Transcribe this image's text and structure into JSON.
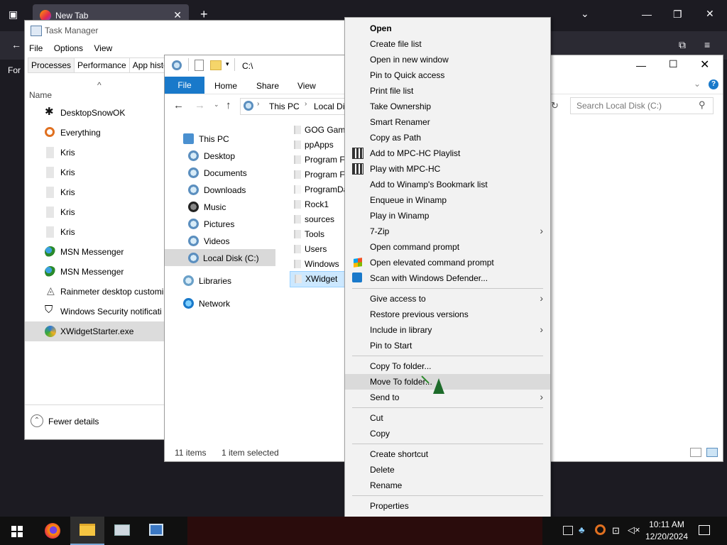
{
  "browser": {
    "tab_title": "New Tab",
    "partial_text": "For"
  },
  "taskmgr": {
    "title": "Task Manager",
    "menu": [
      "File",
      "Options",
      "View"
    ],
    "tabs": [
      "Processes",
      "Performance",
      "App histo"
    ],
    "column_name": "Name",
    "processes": [
      {
        "name": "DesktopSnowOK",
        "icon": "snowflake-icon"
      },
      {
        "name": "Everything",
        "icon": "magnifier-icon"
      },
      {
        "name": "Kris",
        "icon": "generic-app-icon"
      },
      {
        "name": "Kris",
        "icon": "generic-app-icon"
      },
      {
        "name": "Kris",
        "icon": "generic-app-icon"
      },
      {
        "name": "Kris",
        "icon": "generic-app-icon"
      },
      {
        "name": "Kris",
        "icon": "generic-app-icon"
      },
      {
        "name": "MSN Messenger",
        "icon": "msn-icon"
      },
      {
        "name": "MSN Messenger",
        "icon": "msn-icon"
      },
      {
        "name": "Rainmeter desktop customi",
        "icon": "rainmeter-icon"
      },
      {
        "name": "Windows Security notificati",
        "icon": "shield-icon"
      },
      {
        "name": "XWidgetStarter.exe",
        "icon": "xwidget-icon"
      }
    ],
    "fewer_details": "Fewer details"
  },
  "explorer": {
    "path_short": "C:\\",
    "ribbon_tabs": [
      "File",
      "Home",
      "Share",
      "View"
    ],
    "breadcrumb": [
      "This PC",
      "Local Disk"
    ],
    "search_placeholder": "Search Local Disk (C:)",
    "nav": {
      "this_pc": "This PC",
      "items": [
        "Desktop",
        "Documents",
        "Downloads",
        "Music",
        "Pictures",
        "Videos",
        "Local Disk (C:)"
      ],
      "libraries": "Libraries",
      "network": "Network"
    },
    "files": [
      "GOG Games",
      "ppApps",
      "Program Files",
      "Program Files",
      "ProgramData",
      "Rock1",
      "sources",
      "Tools",
      "Users",
      "Windows",
      "XWidget"
    ],
    "status_items": "11 items",
    "status_selected": "1 item selected"
  },
  "context_menu": {
    "items": [
      {
        "label": "Open",
        "bold": true
      },
      {
        "label": "Create file list"
      },
      {
        "label": "Open in new window"
      },
      {
        "label": "Pin to Quick access"
      },
      {
        "label": "Print file list"
      },
      {
        "label": "Take Ownership"
      },
      {
        "label": "Smart Renamer"
      },
      {
        "label": "Copy as Path"
      },
      {
        "label": "Add to MPC-HC Playlist",
        "icon": "mpc-hc-icon"
      },
      {
        "label": "Play with MPC-HC",
        "icon": "mpc-hc-icon"
      },
      {
        "label": "Add to Winamp's Bookmark list"
      },
      {
        "label": "Enqueue in Winamp"
      },
      {
        "label": "Play in Winamp"
      },
      {
        "label": "7-Zip",
        "submenu": true
      },
      {
        "label": "Open command prompt"
      },
      {
        "label": "Open elevated command prompt",
        "icon": "windows-flag-icon"
      },
      {
        "label": "Scan with Windows Defender...",
        "icon": "defender-icon"
      },
      {
        "label": "Give access to",
        "submenu": true
      },
      {
        "label": "Restore previous versions"
      },
      {
        "label": "Include in library",
        "submenu": true
      },
      {
        "label": "Pin to Start"
      },
      {
        "label": "Copy To folder..."
      },
      {
        "label": "Move To folder...",
        "highlighted": true
      },
      {
        "label": "Send to",
        "submenu": true
      },
      {
        "label": "Cut"
      },
      {
        "label": "Copy"
      },
      {
        "label": "Create shortcut"
      },
      {
        "label": "Delete"
      },
      {
        "label": "Rename"
      },
      {
        "label": "Properties"
      }
    ]
  },
  "taskbar": {
    "time": "10:11 AM",
    "date": "12/20/2024",
    "apps": [
      "firefox-icon",
      "file-explorer-icon",
      "task-manager-icon",
      "control-panel-icon"
    ]
  },
  "colors": {
    "accent": "#1979ca",
    "selection": "#cce8ff",
    "menu_bg": "#f2f2f2"
  }
}
